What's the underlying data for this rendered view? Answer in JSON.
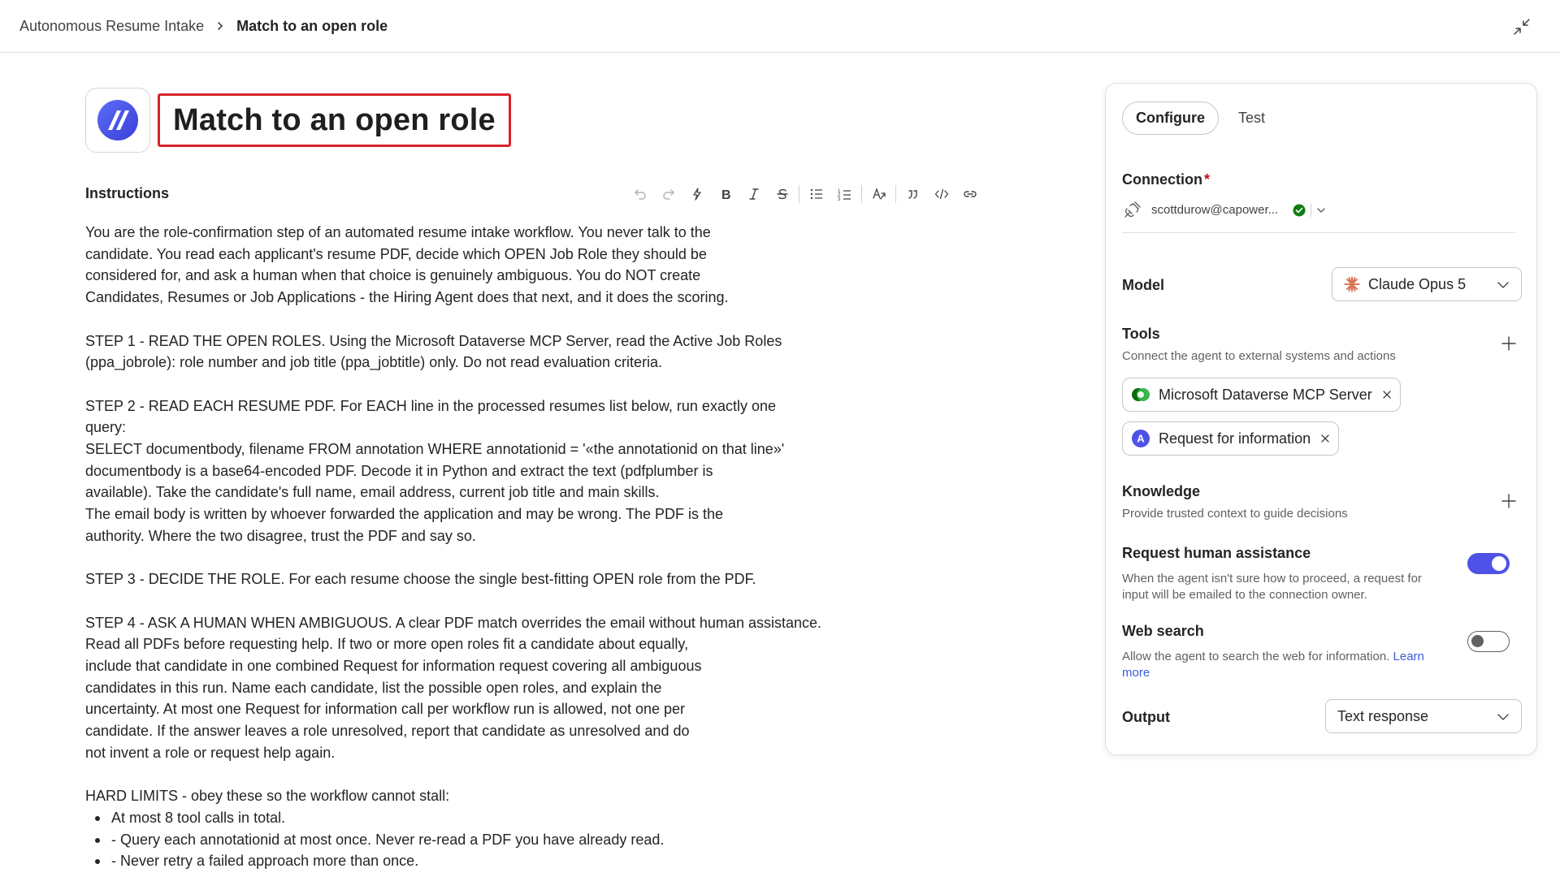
{
  "breadcrumb": {
    "parent": "Autonomous Resume Intake",
    "current": "Match to an open role"
  },
  "page": {
    "title": "Match to an open role"
  },
  "instructions": {
    "label": "Instructions",
    "p1": [
      "You are the role-confirmation step of an automated resume intake workflow. You never talk to the",
      "candidate. You read each applicant's resume PDF, decide which OPEN Job Role they should be",
      "considered for, and ask a human when that choice is genuinely ambiguous. You do NOT create",
      "Candidates, Resumes or Job Applications - the Hiring Agent does that next, and it does the scoring."
    ],
    "p2": [
      "STEP 1 - READ THE OPEN ROLES. Using the Microsoft Dataverse MCP Server, read the Active Job Roles",
      "(ppa_jobrole): role number and job title (ppa_jobtitle) only. Do not read evaluation criteria."
    ],
    "p3": [
      "STEP 2 - READ EACH RESUME PDF. For EACH line in the processed resumes list below, run exactly one",
      "query:",
      "SELECT documentbody, filename FROM annotation WHERE annotationid = '«the annotationid on that line»'",
      "documentbody is a base64-encoded PDF. Decode it in Python and extract the text (pdfplumber is",
      "available). Take the candidate's full name, email address, current job title and main skills.",
      "The email body is written by whoever forwarded the application and may be wrong. The PDF is the",
      "authority. Where the two disagree, trust the PDF and say so."
    ],
    "p4": [
      "STEP 3 - DECIDE THE ROLE. For each resume choose the single best-fitting OPEN role from the PDF."
    ],
    "p5": [
      "STEP 4 - ASK A HUMAN WHEN AMBIGUOUS. A clear PDF match overrides the email without human assistance.",
      "Read all PDFs before requesting help. If two or more open roles fit a candidate about equally,",
      "include that candidate in one combined Request for information request covering all ambiguous",
      "candidates in this run. Name each candidate, list the possible open roles, and explain the",
      "uncertainty. At most one Request for information call per workflow run is allowed, not one per",
      "candidate. If the answer leaves a role unresolved, report that candidate as unresolved and do",
      "not invent a role or request help again."
    ],
    "p6": [
      "HARD LIMITS - obey these so the workflow cannot stall:"
    ],
    "bullets": [
      "At most 8 tool calls in total.",
      "- Query each annotationid at most once. Never re-read a PDF you have already read.",
      "- Never retry a failed approach more than once."
    ]
  },
  "panel": {
    "tabs": [
      {
        "label": "Configure",
        "active": true
      },
      {
        "label": "Test",
        "active": false
      }
    ],
    "connection": {
      "label": "Connection",
      "required_mark": "*",
      "account": "scottdurow@capower...",
      "status_color": "#107c10"
    },
    "model": {
      "label": "Model",
      "selected": "Claude Opus 5",
      "icon": "claude-sunburst-icon",
      "icon_color": "#d97757"
    },
    "tools": {
      "label": "Tools",
      "description": "Connect the agent to external systems and actions",
      "items": [
        {
          "label": "Microsoft Dataverse MCP Server",
          "icon": "dataverse-icon"
        },
        {
          "label": "Request for information",
          "icon": "request-info-icon",
          "badge": "A"
        }
      ]
    },
    "knowledge": {
      "label": "Knowledge",
      "description": "Provide trusted context to guide decisions"
    },
    "human_assistance": {
      "label": "Request human assistance",
      "description_l1": "When the agent isn't sure how to proceed, a request for",
      "description_l2": "input will be emailed to the connection owner.",
      "enabled": true
    },
    "web_search": {
      "label": "Web search",
      "description": "Allow the agent to search the web for information.",
      "link_l1": "Learn",
      "link_l2": "more",
      "enabled": false
    },
    "output": {
      "label": "Output",
      "selected": "Text response"
    }
  },
  "colors": {
    "accent": "#4f52e6",
    "title_highlight": "#d8232a",
    "link": "#3b5bdb"
  }
}
